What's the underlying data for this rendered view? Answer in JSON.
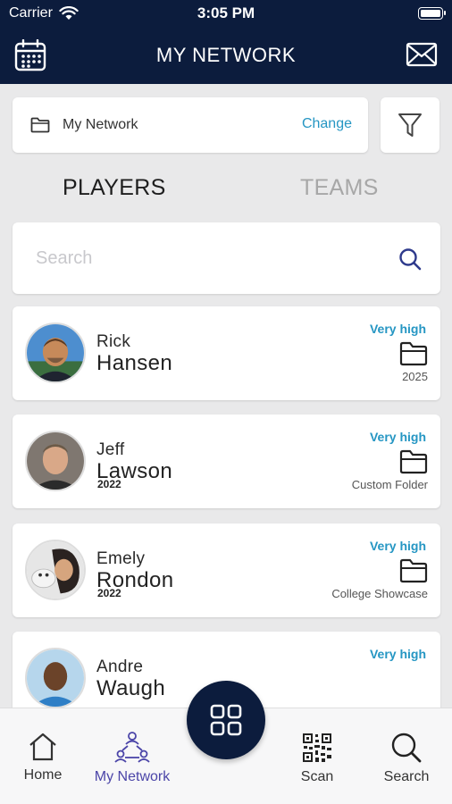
{
  "status_bar": {
    "carrier": "Carrier",
    "time": "3:05 PM"
  },
  "header": {
    "title": "MY NETWORK"
  },
  "network_selector": {
    "label": "My Network",
    "change_label": "Change"
  },
  "tabs": [
    {
      "label": "PLAYERS",
      "active": true
    },
    {
      "label": "TEAMS",
      "active": false
    }
  ],
  "search": {
    "placeholder": "Search",
    "value": ""
  },
  "players": [
    {
      "first_name": "Rick",
      "last_name": "Hansen",
      "year": "",
      "rating": "Very high",
      "folder": "2025"
    },
    {
      "first_name": "Jeff",
      "last_name": "Lawson",
      "year": "2022",
      "rating": "Very high",
      "folder": "Custom Folder"
    },
    {
      "first_name": "Emely",
      "last_name": "Rondon",
      "year": "2022",
      "rating": "Very high",
      "folder": "College Showcase"
    },
    {
      "first_name": "Andre",
      "last_name": "Waugh",
      "year": "",
      "rating": "Very high",
      "folder": ""
    }
  ],
  "bottom_nav": [
    {
      "label": "Home",
      "icon": "home-icon",
      "active": false
    },
    {
      "label": "My Network",
      "icon": "network-icon",
      "active": true
    },
    {
      "label": "Scan",
      "icon": "qr-code-icon",
      "active": false
    },
    {
      "label": "Search",
      "icon": "search-icon",
      "active": false
    }
  ],
  "colors": {
    "header_bg": "#0c1c3d",
    "accent": "#2596c3",
    "active_nav": "#4b45a8"
  }
}
